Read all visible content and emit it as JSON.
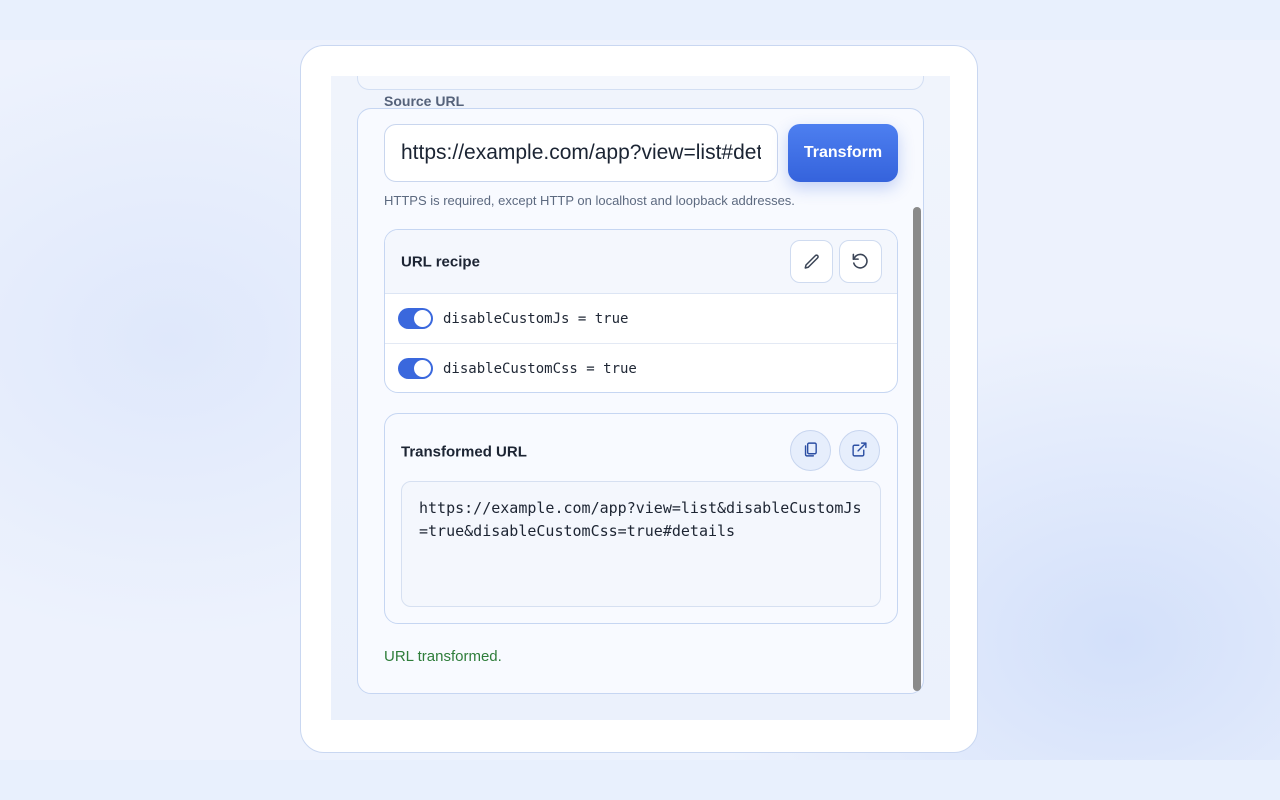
{
  "form": {
    "source_label": "Source URL",
    "url_value": "https://example.com/app?view=list#details",
    "transform_label": "Transform",
    "hint": "HTTPS is required, except HTTP on localhost and loopback addresses."
  },
  "recipe": {
    "title": "URL recipe",
    "edit_icon": "pencil-icon",
    "reset_icon": "rotate-ccw-icon",
    "rows": [
      {
        "label": "disableCustomJs = true",
        "enabled": true
      },
      {
        "label": "disableCustomCss = true",
        "enabled": true
      }
    ]
  },
  "result": {
    "title": "Transformed URL",
    "copy_icon": "copy-icon",
    "open_icon": "external-link-icon",
    "url": "https://example.com/app?view=list&disableCustomJs=true&disableCustomCss=true#details"
  },
  "status": {
    "message": "URL transformed.",
    "color": "#2e7d3a"
  },
  "colors": {
    "accent": "#3a68dd",
    "status_success": "#2e7d3a",
    "scrollbar": "#8a8a8a"
  }
}
